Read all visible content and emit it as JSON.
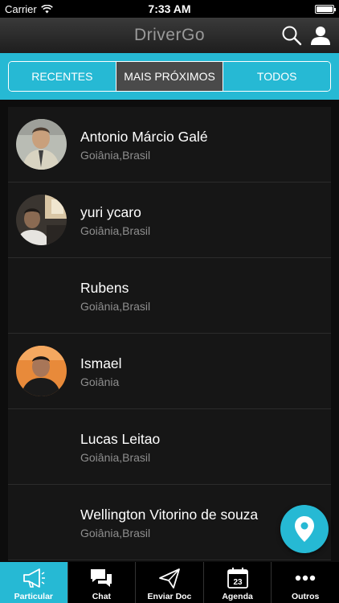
{
  "status_bar": {
    "carrier": "Carrier",
    "time": "7:33 AM",
    "battery_level": 1.0
  },
  "header": {
    "title": "DriverGo"
  },
  "segments": [
    {
      "label": "RECENTES",
      "active": false
    },
    {
      "label": "MAIS PRÓXIMOS",
      "active": true
    },
    {
      "label": "TODOS",
      "active": false
    }
  ],
  "drivers": [
    {
      "name": "Antonio Márcio Galé",
      "location": "Goiânia,Brasil",
      "has_photo": true
    },
    {
      "name": "yuri ycaro",
      "location": "Goiânia,Brasil",
      "has_photo": true
    },
    {
      "name": "Rubens",
      "location": "Goiânia,Brasil",
      "has_photo": false
    },
    {
      "name": "Ismael",
      "location": "Goiânia",
      "has_photo": true
    },
    {
      "name": "Lucas Leitao",
      "location": "Goiânia,Brasil",
      "has_photo": false
    },
    {
      "name": "Wellington Vitorino de souza",
      "location": "Goiânia,Brasil",
      "has_photo": false
    }
  ],
  "tabs": [
    {
      "label": "Particular",
      "icon": "megaphone-icon",
      "active": true
    },
    {
      "label": "Chat",
      "icon": "chat-bubbles-icon",
      "active": false
    },
    {
      "label": "Enviar Doc",
      "icon": "paper-plane-icon",
      "active": false
    },
    {
      "label": "Agenda",
      "icon": "calendar-icon",
      "active": false,
      "badge": "23"
    },
    {
      "label": "Outros",
      "icon": "more-dots-icon",
      "active": false
    }
  ],
  "colors": {
    "accent": "#26b9d4",
    "active_segment": "#4a4a4a",
    "background": "#0d0d0d",
    "list_item": "#161616"
  }
}
